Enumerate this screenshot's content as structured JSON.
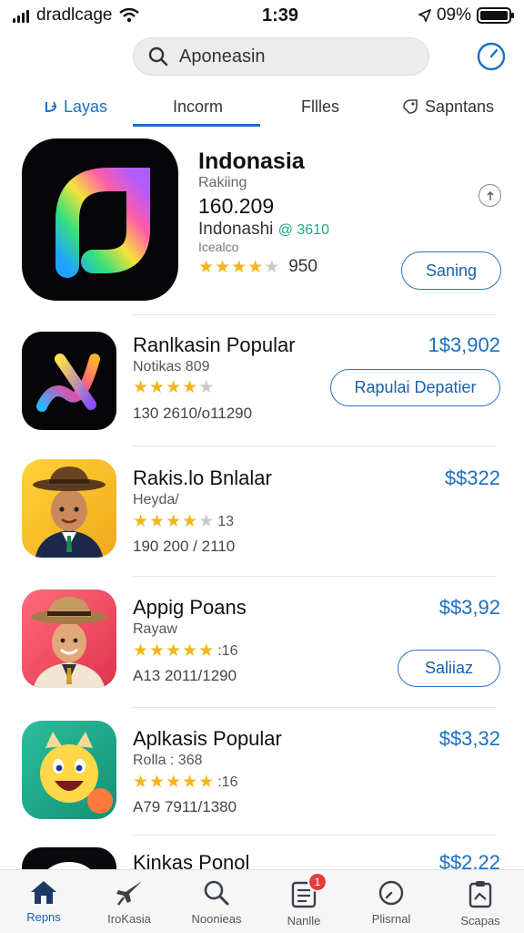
{
  "status_bar": {
    "carrier": "dradlcage",
    "time": "1:39",
    "battery": "09%"
  },
  "search": {
    "value": "Aponeasin"
  },
  "tabs": [
    {
      "label": "Layas"
    },
    {
      "label": "Incorm"
    },
    {
      "label": "Fllles"
    },
    {
      "label": "Sapntans"
    }
  ],
  "featured": {
    "title": "Indonasia",
    "subtitle": "Rakiing",
    "count": "160.209",
    "line": "Indonashi",
    "accent": "@ 3610",
    "tiny": "Icealco",
    "rating_count": "950",
    "rating": 4,
    "button": "Saning"
  },
  "apps": [
    {
      "name": "Ranlkasin Popular",
      "sub": "Notikas 809",
      "rating": 4.5,
      "rating_text": "",
      "meta": "130 2610/o11290",
      "price": "1$3,902",
      "button": "Rapulai Depatier"
    },
    {
      "name": "Rakis.lo Bnlalar",
      "sub": "Heyda/",
      "rating": 4,
      "rating_text": "13",
      "meta": "190 200 / 2110",
      "price": "$$322",
      "button": ""
    },
    {
      "name": "Appig Poans",
      "sub": "Rayaw",
      "rating": 5,
      "rating_text": ":16",
      "meta": "A13 2011/1290",
      "price": "$$3,92",
      "button": "Saliiaz"
    },
    {
      "name": "Aplkasis Popular",
      "sub": "Rolla : 368",
      "rating": 5,
      "rating_text": ":16",
      "meta": "A79 7911/1380",
      "price": "$$3,32",
      "button": ""
    },
    {
      "name": "Kinkas Ponol",
      "price": "$$2.22"
    }
  ],
  "bottom_nav": [
    {
      "label": "Repns"
    },
    {
      "label": "IroKasia"
    },
    {
      "label": "Noonieas"
    },
    {
      "label": "Nanlle",
      "badge": "1"
    },
    {
      "label": "Plisrnal"
    },
    {
      "label": "Scapas"
    }
  ],
  "colors": {
    "accent": "#1a6fc4",
    "star": "#f3b51c",
    "badge": "#e53b3b"
  }
}
